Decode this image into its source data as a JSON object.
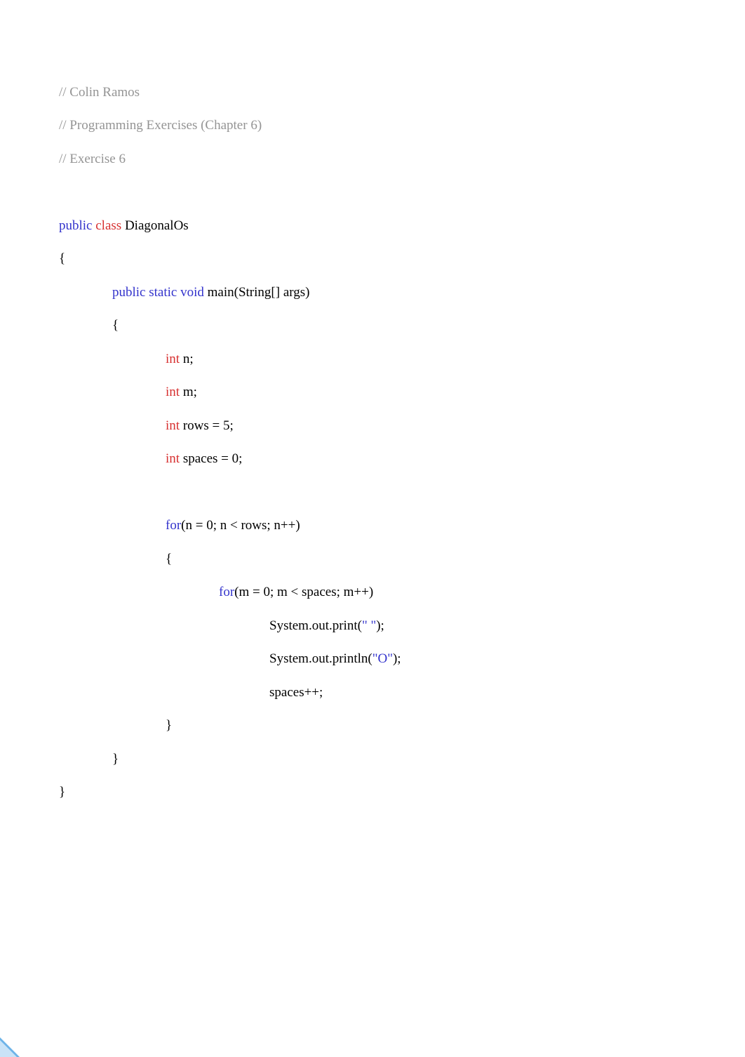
{
  "comments": {
    "line1": "// Colin Ramos",
    "line2": "// Programming Exercises (Chapter 6)",
    "line3": "// Exercise 6"
  },
  "classDecl": {
    "kw_public": "public",
    "kw_class": "class",
    "name": "DiagonalOs"
  },
  "mainDecl": {
    "kw_public": "public",
    "kw_static": "static",
    "kw_void": "void",
    "signature": "main(String[] args)"
  },
  "decls": {
    "int": "int",
    "n": "n;",
    "m": "m;",
    "rows": "rows = 5;",
    "spaces": "spaces = 0;"
  },
  "forOuter": {
    "kw_for": "for",
    "cond": "(n = 0; n < rows; n++)"
  },
  "forInner": {
    "kw_for": "for",
    "cond": "(m = 0; m < spaces; m++)"
  },
  "stmts": {
    "print_pre": "System.out.print(",
    "print_str": "\" \"",
    "print_post": ");",
    "println_pre": "System.out.println(",
    "println_str": "\"O\"",
    "println_post": ");",
    "inc": "spaces++;"
  },
  "braces": {
    "open": "{",
    "close": "}"
  }
}
